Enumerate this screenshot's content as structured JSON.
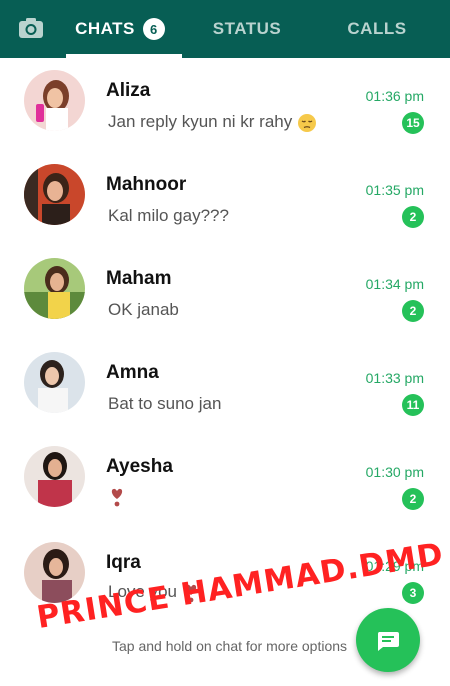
{
  "tabs": {
    "chats_label": "CHATS",
    "chats_badge": "6",
    "status_label": "STATUS",
    "calls_label": "CALLS"
  },
  "chats": [
    {
      "name": "Aliza",
      "message": "Jan reply kyun ni kr rahy",
      "time": "01:36 pm",
      "unread": "15",
      "emoji": "pensive-face-icon"
    },
    {
      "name": "Mahnoor",
      "message": "Kal milo gay???",
      "time": "01:35 pm",
      "unread": "2"
    },
    {
      "name": "Maham",
      "message": "OK janab",
      "time": "01:34 pm",
      "unread": "2"
    },
    {
      "name": "Amna",
      "message": "Bat to suno jan",
      "time": "01:33 pm",
      "unread": "11"
    },
    {
      "name": "Ayesha",
      "message": "",
      "time": "01:30 pm",
      "unread": "2",
      "emoji": "heart-exclamation-icon"
    },
    {
      "name": "Iqra",
      "message": "Love you",
      "time": "01:29 pm",
      "unread": "3",
      "emoji": "heart-exclamation-icon"
    }
  ],
  "hint": "Tap and hold on chat for more options",
  "watermark": "PRINCE HAMMAD.DMD",
  "colors": {
    "header": "#075e54",
    "accent": "#25c159",
    "time": "#25a865"
  }
}
